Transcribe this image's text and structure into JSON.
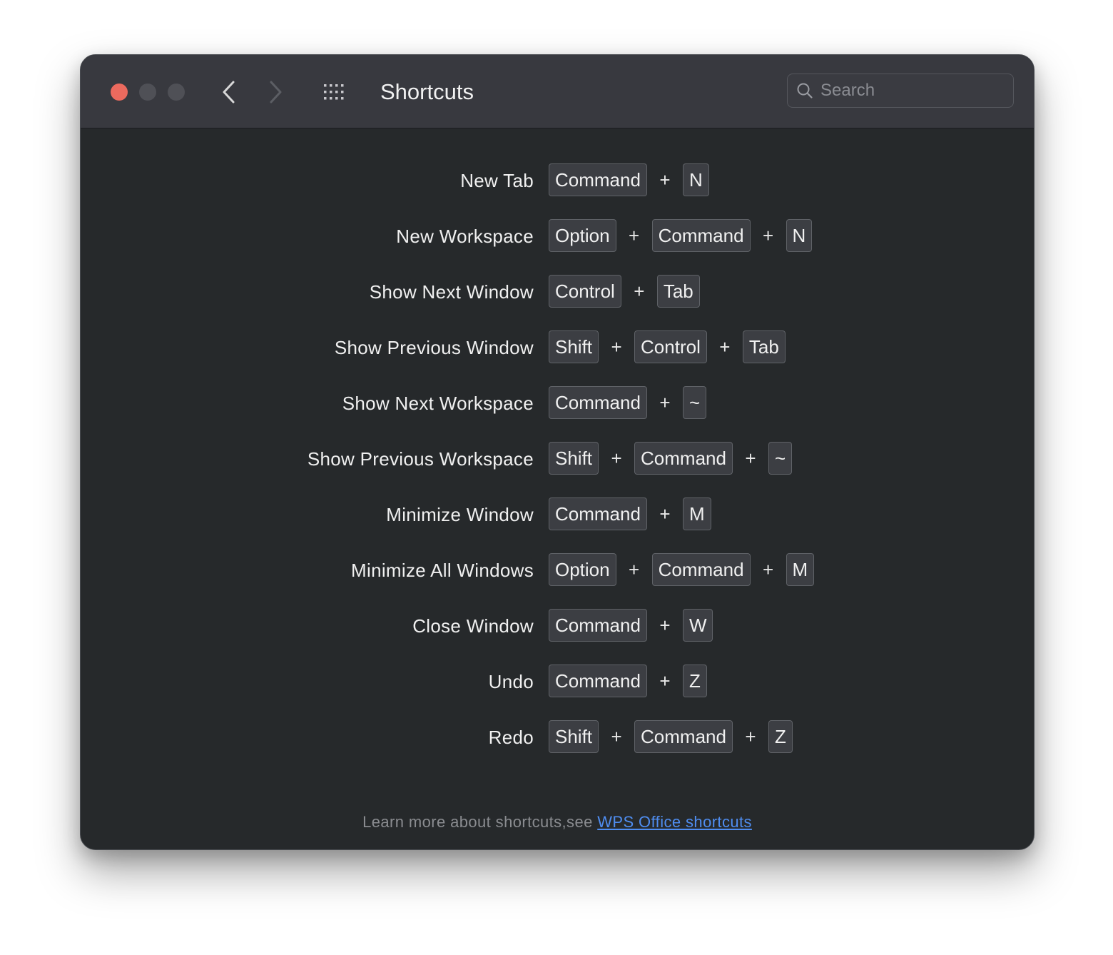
{
  "window": {
    "title": "Shortcuts"
  },
  "search": {
    "placeholder": "Search"
  },
  "shortcuts": [
    {
      "label": "New Tab",
      "keys": [
        "Command",
        "N"
      ]
    },
    {
      "label": "New Workspace",
      "keys": [
        "Option",
        "Command",
        "N"
      ]
    },
    {
      "label": "Show Next Window",
      "keys": [
        "Control",
        "Tab"
      ]
    },
    {
      "label": "Show Previous Window",
      "keys": [
        "Shift",
        "Control",
        "Tab"
      ]
    },
    {
      "label": "Show Next Workspace",
      "keys": [
        "Command",
        "~"
      ]
    },
    {
      "label": "Show Previous Workspace",
      "keys": [
        "Shift",
        "Command",
        "~"
      ]
    },
    {
      "label": "Minimize Window",
      "keys": [
        "Command",
        "M"
      ]
    },
    {
      "label": "Minimize All Windows",
      "keys": [
        "Option",
        "Command",
        "M"
      ]
    },
    {
      "label": "Close Window",
      "keys": [
        "Command",
        "W"
      ]
    },
    {
      "label": "Undo",
      "keys": [
        "Command",
        "Z"
      ]
    },
    {
      "label": "Redo",
      "keys": [
        "Shift",
        "Command",
        "Z"
      ]
    }
  ],
  "key_separator": "+",
  "footer": {
    "text": "Learn more about shortcuts,see ",
    "link_text": "WPS Office shortcuts"
  },
  "colors": {
    "close_button": "#ec6a5e",
    "link": "#4f8df0",
    "background": "#26292b",
    "titlebar": "#38393f"
  },
  "icons": [
    "close-window-button",
    "minimize-window-button",
    "zoom-window-button",
    "chevron-left-icon",
    "chevron-right-icon",
    "grid-icon",
    "search-icon"
  ]
}
